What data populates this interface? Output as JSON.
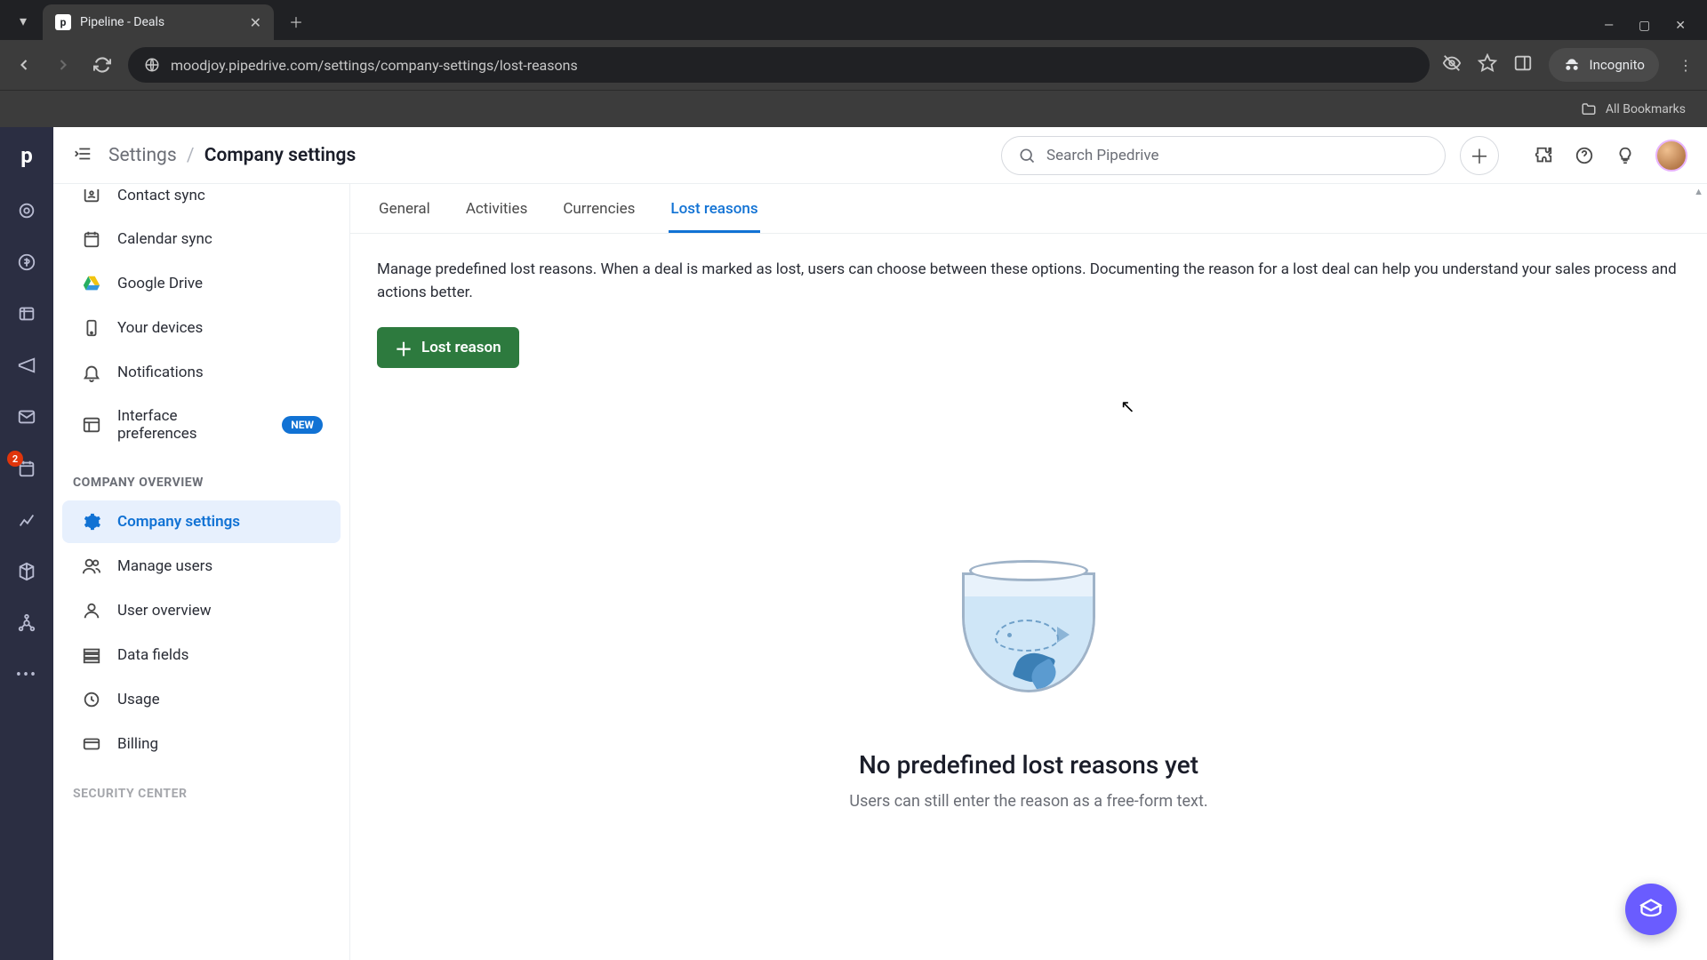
{
  "browser": {
    "tab_title": "Pipeline - Deals",
    "url": "moodjoy.pipedrive.com/settings/company-settings/lost-reasons",
    "incognito_label": "Incognito",
    "all_bookmarks": "All Bookmarks"
  },
  "rail": {
    "badge": "2"
  },
  "breadcrumb": {
    "root": "Settings",
    "current": "Company settings"
  },
  "search": {
    "placeholder": "Search Pipedrive"
  },
  "sidebar": {
    "items_top": [
      {
        "label": "Contact sync",
        "icon": "contact"
      },
      {
        "label": "Calendar sync",
        "icon": "calendar"
      },
      {
        "label": "Google Drive",
        "icon": "gdrive"
      },
      {
        "label": "Your devices",
        "icon": "device"
      },
      {
        "label": "Notifications",
        "icon": "bell"
      },
      {
        "label": "Interface preferences",
        "icon": "pref",
        "badge": "NEW"
      }
    ],
    "section1": "COMPANY OVERVIEW",
    "items_company": [
      {
        "label": "Company settings",
        "icon": "gear",
        "active": true
      },
      {
        "label": "Manage users",
        "icon": "users"
      },
      {
        "label": "User overview",
        "icon": "user"
      },
      {
        "label": "Data fields",
        "icon": "fields"
      },
      {
        "label": "Usage",
        "icon": "usage"
      },
      {
        "label": "Billing",
        "icon": "billing"
      }
    ],
    "section2": "SECURITY CENTER"
  },
  "tabs": [
    "General",
    "Activities",
    "Currencies",
    "Lost reasons"
  ],
  "active_tab": "Lost reasons",
  "content": {
    "description": "Manage predefined lost reasons. When a deal is marked as lost, users can choose between these options. Documenting the reason for a lost deal can help you understand your sales process and actions better.",
    "add_button": "Lost reason",
    "empty_title": "No predefined lost reasons yet",
    "empty_subtitle": "Users can still enter the reason as a free-form text."
  }
}
